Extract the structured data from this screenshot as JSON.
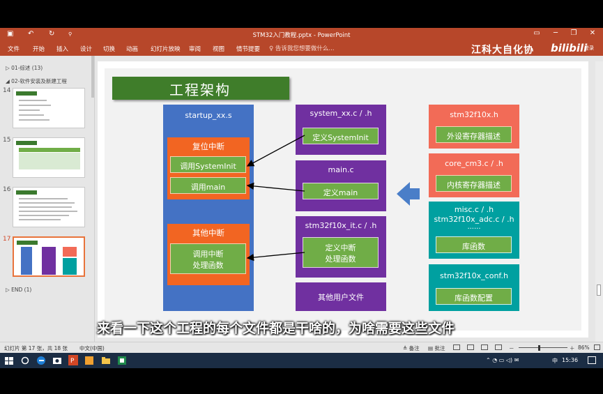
{
  "window": {
    "title": "STM32入门教程.pptx - PowerPoint",
    "minimize": "─",
    "restore": "❐",
    "close": "✕",
    "ribbon_options": "▭"
  },
  "quick_access": {
    "save": "▣",
    "undo": "↶",
    "redo": "↻",
    "customize": "⚲"
  },
  "ribbon": {
    "tabs": [
      "文件",
      "开始",
      "插入",
      "设计",
      "切换",
      "动画",
      "幻灯片放映",
      "审阅",
      "视图",
      "情节提要"
    ],
    "tell_me": "♀ 告诉我您想要做什么...",
    "watermark": "江科大自化协",
    "bilibili": "bilibili",
    "login": "登录"
  },
  "slide_panel": {
    "sections": [
      {
        "label": "▷ 01-综述 (13)"
      },
      {
        "label": "◢ 02-软件安装及新建工程"
      },
      {
        "label": "▷ END (1)"
      }
    ],
    "slides": [
      {
        "number": "14"
      },
      {
        "number": "15"
      },
      {
        "number": "16"
      },
      {
        "number": "17"
      }
    ]
  },
  "slide": {
    "title": "工程架构",
    "startup": {
      "file": "startup_xx.s",
      "reset_label": "复位中断",
      "call_systeminit": "调用SystemInit",
      "call_main": "调用main",
      "other_label": "其他中断",
      "call_handler_line1": "调用中断",
      "call_handler_line2": "处理函数"
    },
    "system": {
      "file": "system_xx.c / .h",
      "define": "定义SystemInit"
    },
    "main": {
      "file": "main.c",
      "define": "定义main"
    },
    "it": {
      "file": "stm32f10x_it.c / .h",
      "define_line1": "定义中断",
      "define_line2": "处理函数"
    },
    "user": {
      "label": "其他用户文件"
    },
    "periph": {
      "file": "stm32f10x.h",
      "desc": "外设寄存器描述"
    },
    "core": {
      "file": "core_cm3.c / .h",
      "desc": "内核寄存器描述"
    },
    "lib": {
      "file_line1": "misc.c / .h",
      "file_line2": "stm32f10x_adc.c / .h",
      "file_line3": "......",
      "desc": "库函数"
    },
    "conf": {
      "file": "stm32f10x_conf.h",
      "desc": "库函数配置"
    }
  },
  "subtitle": "来看一下这个工程的每个文件都是干啥的，为啥需要这些文件",
  "status_bar": {
    "slide_info": "幻灯片 第 17 张，共 18 张",
    "language": "中文(中国)",
    "notes": "≜ 备注",
    "comments": "▤ 批注",
    "zoom_minus": "－",
    "zoom_plus": "＋",
    "zoom": "86%"
  },
  "taskbar": {
    "clock": "15:36",
    "input_method": "中",
    "tray_icons": "⌃ ◔ ▭ ◁) ✉"
  },
  "colors": {
    "ribbon": "#b7472a",
    "title_green": "#3f7d2a",
    "startup_blue": "#4472c4",
    "orange": "#f26522",
    "green": "#70ad47",
    "purple": "#7030a0",
    "salmon": "#f26b57",
    "teal": "#00a0a0",
    "arrow_blue": "#4a7ec8"
  }
}
